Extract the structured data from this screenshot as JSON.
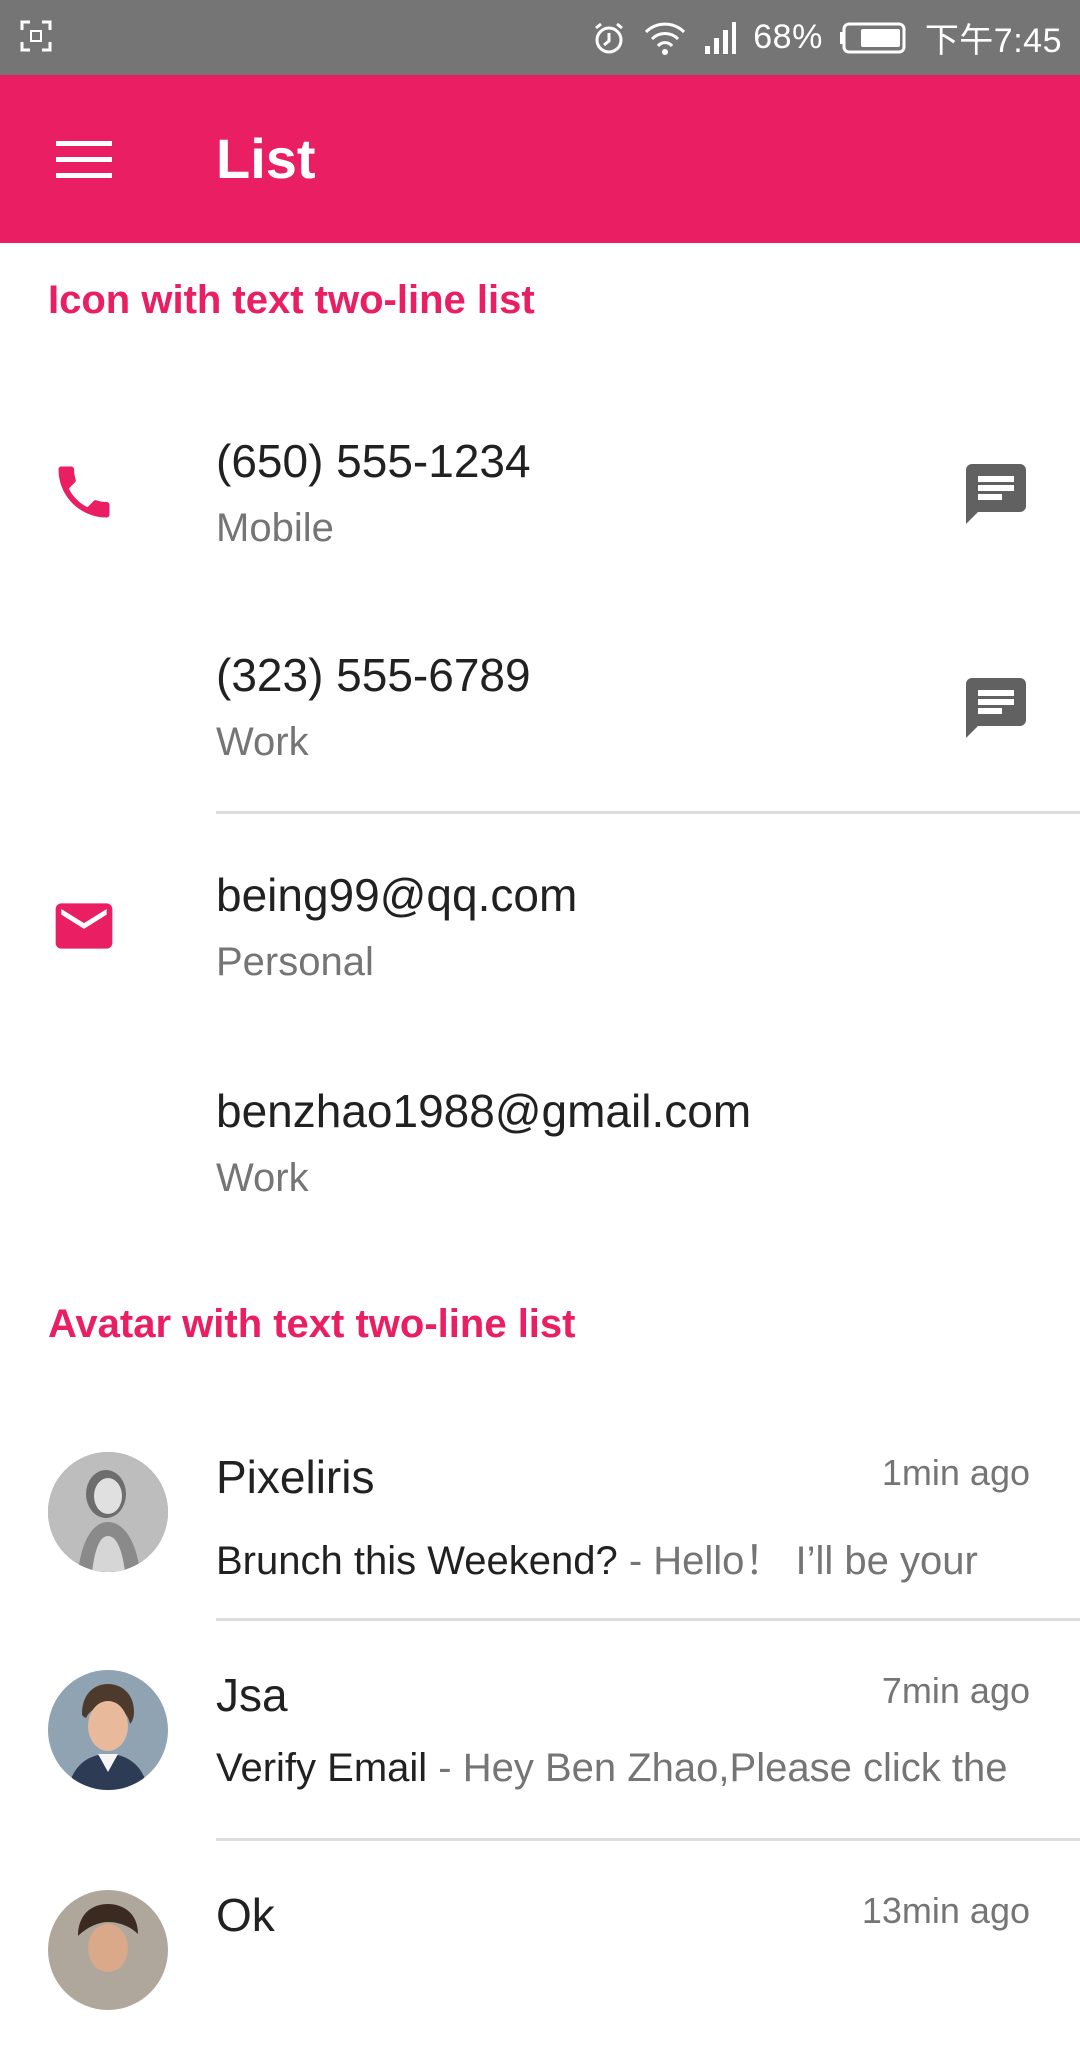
{
  "status_bar": {
    "battery": "68%",
    "time": "下午7:45",
    "icons": [
      "screenshot-icon",
      "alarm-icon",
      "wifi-icon",
      "signal-icon",
      "battery-icon"
    ]
  },
  "app_bar": {
    "title": "List",
    "menu_icon": "menu-icon"
  },
  "colors": {
    "primary": "#e91e63",
    "status_bar": "#757575",
    "text_primary": "#212121",
    "text_secondary": "#757575",
    "action_icon": "#616161"
  },
  "icon_section": {
    "header": "Icon with text two-line list",
    "items": [
      {
        "primary": "(650) 555-1234",
        "secondary": "Mobile",
        "leading_icon": "phone-icon",
        "action_icon": "message-icon"
      },
      {
        "primary": "(323) 555-6789",
        "secondary": "Work",
        "action_icon": "message-icon"
      },
      {
        "primary": "being99@qq.com",
        "secondary": "Personal",
        "leading_icon": "mail-icon"
      },
      {
        "primary": "benzhao1988@gmail.com",
        "secondary": "Work"
      }
    ]
  },
  "avatar_section": {
    "header": "Avatar with text two-line list",
    "items": [
      {
        "name": "Pixeliris",
        "time": "1min ago",
        "subject": "Brunch this Weekend?",
        "snippet": " - Hello！ I’ll be your"
      },
      {
        "name": "Jsa",
        "time": "7min ago",
        "subject": "Verify Email",
        "snippet": " - Hey Ben Zhao,Please click the"
      },
      {
        "name": "Ok",
        "time": "13min ago"
      }
    ]
  }
}
